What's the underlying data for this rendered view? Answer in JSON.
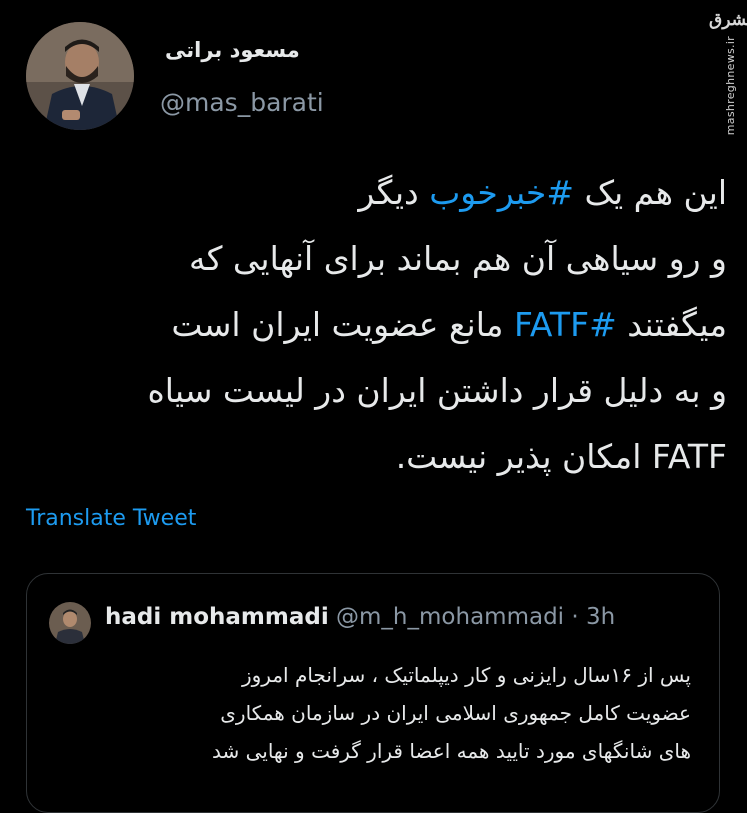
{
  "watermark": {
    "logo_text": "مشرق",
    "url": "mashreghnews.ir"
  },
  "author": {
    "display_name": "مسعود براتی",
    "handle": "@mas_barati"
  },
  "tweet": {
    "lines": [
      {
        "pre": "این هم یک ",
        "hashtag": "#خبرخوب",
        "post": " دیگر"
      },
      {
        "pre": "و رو سیاهی آن هم بماند برای آنهایی که",
        "hashtag": "",
        "post": ""
      },
      {
        "pre": "میگفتند ",
        "hashtag": "#FATF",
        "post": " مانع عضویت ایران است"
      },
      {
        "pre": "و به دلیل قرار داشتن ایران در لیست سیاه",
        "hashtag": "",
        "post": ""
      },
      {
        "pre": "FATF امکان پذیر نیست.",
        "hashtag": "",
        "post": ""
      }
    ],
    "translate_label": "Translate Tweet"
  },
  "quoted": {
    "name": "hadi mohammadi",
    "handle": "@m_h_mohammadi",
    "separator": "·",
    "time": "3h",
    "lines": [
      "پس از ۱۶سال رایزنی و کار دیپلماتیک ، سرانجام امروز",
      "عضویت کامل جمهوری اسلامی ایران در سازمان همکاری",
      "های شانگهای مورد تایید همه اعضا قرار گرفت و نهایی شد"
    ]
  },
  "colors": {
    "background": "#000000",
    "text": "#e7e9ea",
    "secondary": "#8b98a5",
    "link": "#1d9bf0",
    "border": "#2f3336"
  }
}
